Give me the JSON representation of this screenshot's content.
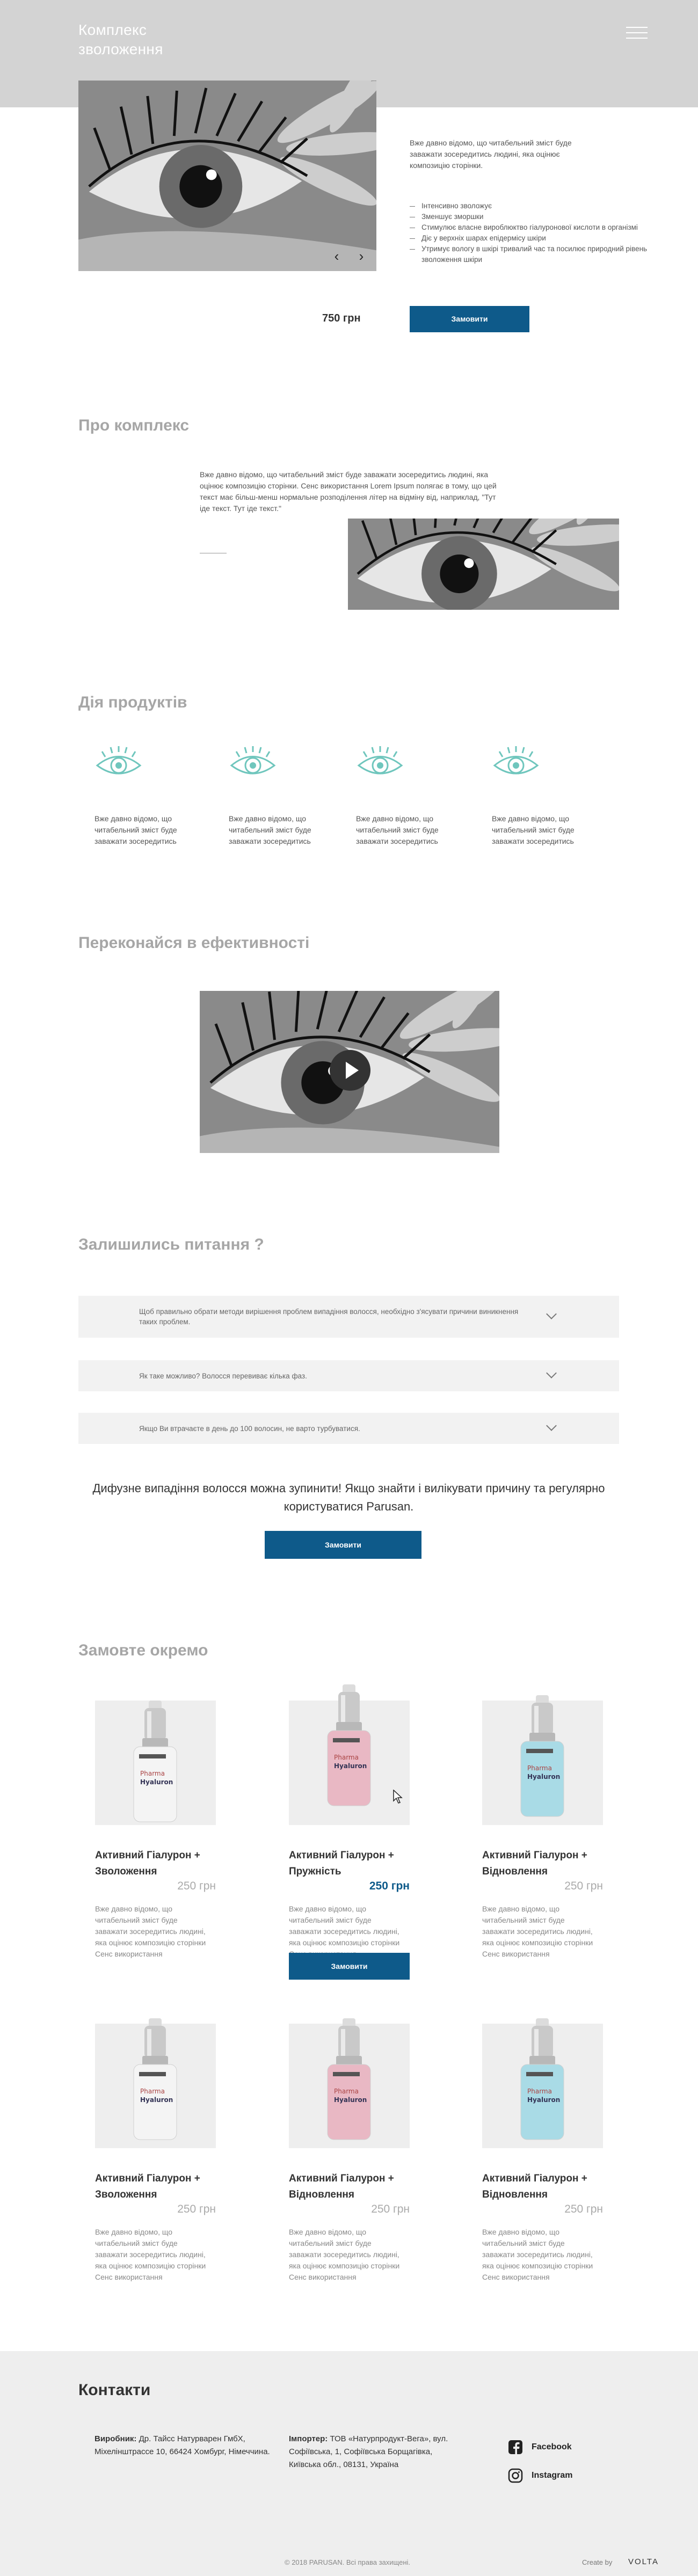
{
  "header": {
    "title_line1": "Комплекс",
    "title_line2": "зволоження"
  },
  "hero": {
    "description": "Вже давно відомо, що читабельний зміст буде заважати зосередитись людині, яка оцінює композицію сторінки.",
    "features": [
      "Інтенсивно зволожує",
      "Зменшує зморшки",
      "Стимулює власне вироблюктво гіалуронової кислоти в організмі",
      "Діє у верхніх шарах епідермісу шкіри",
      "Утримує вологу в шкірі тривалий час та посилює природний рівень зволоження шкіри"
    ],
    "prev_arrow": "‹",
    "next_arrow": "›",
    "price": "750 грн",
    "order_label": "Замовити"
  },
  "about": {
    "title": "Про комплекс",
    "text": "Вже давно відомо, що читабельний зміст буде заважати зосередитись людині, яка оцінює композицію сторінки. Сенс використання Lorem Ipsum полягає в тому, що цей текст має більш-менш нормальне розподілення літер на відміну від, наприклад, \"Тут іде текст. Тут іде текст.\""
  },
  "actions": {
    "title": "Дія продуктів",
    "items": [
      {
        "text": "Вже давно відомо, що читабельний зміст буде заважати зосередитись"
      },
      {
        "text": "Вже давно відомо, що читабельний зміст буде заважати зосередитись"
      },
      {
        "text": "Вже давно відомо, що читабельний зміст буде заважати зосередитись"
      },
      {
        "text": "Вже давно відомо, що читабельний зміст буде заважати зосередитись"
      }
    ]
  },
  "proof": {
    "title": "Переконайся в ефективності"
  },
  "faq": {
    "title": "Залишились питання ?",
    "items": [
      {
        "question": "Щоб правильно обрати методи вирішення проблем випадіння волосся, необхідно з'ясувати причини виникнення таких проблем."
      },
      {
        "question": "Як таке можливо? Волосся перевиває кілька фаз."
      },
      {
        "question": "Якщо Ви втрачаєте в день до 100 волосин, не варто турбуватися."
      }
    ],
    "summary": "Дифузне випадіння волосся можна зупинити! Якщо знайти і вилікувати причину та регулярно користуватися Parusan.",
    "order_label": "Замовити"
  },
  "separate": {
    "title": "Замовте окремо",
    "order_label": "Замовити",
    "products": [
      {
        "name": "Активний Гіалурон + Зволоження",
        "price": "250 грн",
        "desc": "Вже давно відомо, що читабельний зміст буде заважати зосередитись людині, яка оцінює композицію сторінки Сенс використання",
        "brand": "DOPPELHERZ",
        "label": "Pharma Hyaluron"
      },
      {
        "name": "Активний Гіалурон + Пружність",
        "price": "250 грн",
        "desc": "Вже давно відомо, що читабельний зміст буде заважати зосередитись людині, яка оцінює композицію сторінки Сенс використання",
        "brand": "DOPPELHERZ",
        "label": "Pharma Hyaluron"
      },
      {
        "name": "Активний Гіалурон + Відновлення",
        "price": "250 грн",
        "desc": "Вже давно відомо, що читабельний зміст буде заважати зосередитись людині, яка оцінює композицію сторінки Сенс використання",
        "brand": "DOPPELHERZ",
        "label": "Pharma Hyaluron"
      },
      {
        "name": "Активний Гіалурон + Зволоження",
        "price": "250 грн",
        "desc": "Вже давно відомо, що читабельний зміст буде заважати зосередитись людині, яка оцінює композицію сторінки Сенс використання",
        "brand": "DOPPELHERZ",
        "label": "Pharma Hyaluron"
      },
      {
        "name": "Активний Гіалурон + Відновлення",
        "price": "250 грн",
        "desc": "Вже давно відомо, що читабельний зміст буде заважати зосередитись людині, яка оцінює композицію сторінки Сенс використання",
        "brand": "DOPPELHERZ",
        "label": "Pharma Hyaluron"
      },
      {
        "name": "Активний Гіалурон + Відновлення",
        "price": "250 грн",
        "desc": "Вже давно відомо, що читабельний зміст буде заважати зосередитись людині, яка оцінює композицію сторінки Сенс використання",
        "brand": "DOPPELHERZ",
        "label": "Pharma Hyaluron"
      }
    ]
  },
  "footer": {
    "title": "Контакти",
    "producer_label": "Виробник:",
    "producer_text": "Др. Тайсс Натурварен ГмбХ, Міхелінштрассе 10, 66424 Хомбург, Німеччина.",
    "importer_label": "Імпортер:",
    "importer_text": "ТОВ «Натурпродукт-Вега», вул. Софіївська, 1, Софіївська Борщагівка, Київська обл., 08131, Україна",
    "facebook": "Facebook",
    "instagram": "Instagram",
    "copyright": "© 2018 PARUSAN. Всі права захищені.",
    "created_by": "Create by",
    "studio": "VOLTA"
  },
  "colors": {
    "accent": "#0e5a8a",
    "header_bg": "#d3d3d3",
    "icon_teal": "#6fc6bd",
    "bottle_pink": "#e9b8c4",
    "bottle_blue": "#a9dbe6",
    "bottle_white": "#f4f4f4"
  }
}
